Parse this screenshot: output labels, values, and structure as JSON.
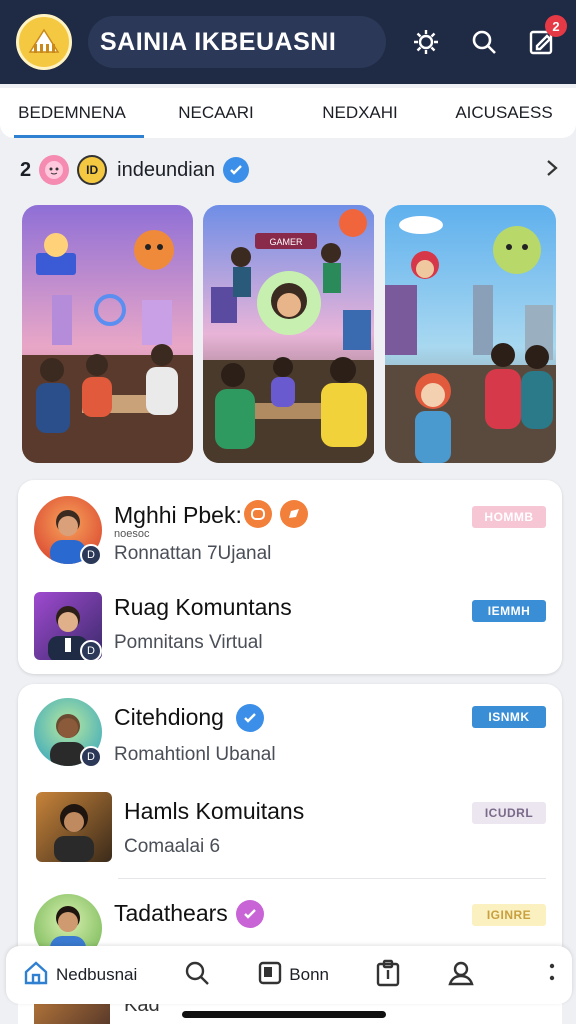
{
  "header": {
    "title": "SAINIA IKBEUASNI",
    "notification_count": "2",
    "icons": [
      "app-logo",
      "settings-icon",
      "search-icon",
      "compose-icon"
    ]
  },
  "tabs": [
    {
      "label": "BEDEMNENA",
      "active": true
    },
    {
      "label": "NECAARI",
      "active": false
    },
    {
      "label": "NEDXAHI",
      "active": false
    },
    {
      "label": "AICUSAESS",
      "active": false
    }
  ],
  "section": {
    "count": "2",
    "avatar_text": "ID",
    "label": "indeundian"
  },
  "featured_cards": [
    {
      "name": "featured-card-1",
      "icon": "game-scene-image"
    },
    {
      "name": "featured-card-2",
      "icon": "game-scene-image",
      "sign": "GAMER"
    },
    {
      "name": "featured-card-3",
      "icon": "game-scene-image"
    }
  ],
  "list_group_1": [
    {
      "name": "Mghhi Pbek:",
      "small": "noesoc",
      "subtitle": "Ronnattan 7Ujanal",
      "tag": "HOMMB",
      "tag_color": "#f7c6d4",
      "badge": "D"
    },
    {
      "name": "Ruag Komuntans",
      "subtitle": "Pomnitans Virtual",
      "tag": "IEMMH",
      "tag_color": "#3a8ed6",
      "badge": "D"
    }
  ],
  "list_group_2": [
    {
      "name": "Citehdiong",
      "subtitle": "Romahtionl Ubanal",
      "tag": "ISNMK",
      "tag_color": "#3a8ed6",
      "badge": "D"
    },
    {
      "name": "Hamls Komuitans",
      "subtitle": "Comaalai 6",
      "tag": "ICUDRL",
      "tag_color": "#ece6f0"
    },
    {
      "name": "Tadathears",
      "subtitle": "",
      "tag": "IGINRE",
      "tag_color": "#fbf0c0"
    }
  ],
  "peek_row": {
    "name": "Kad"
  },
  "bottom_nav": {
    "home_label": "Nedbusnai",
    "book_label": "Bonn",
    "icons": [
      "home-icon",
      "search-icon",
      "book-icon",
      "clipboard-icon",
      "profile-icon",
      "more-icon"
    ]
  },
  "colors": {
    "header_bg": "#1f2a44",
    "accent": "#2f80d1",
    "verified": "#3b8fe8"
  }
}
